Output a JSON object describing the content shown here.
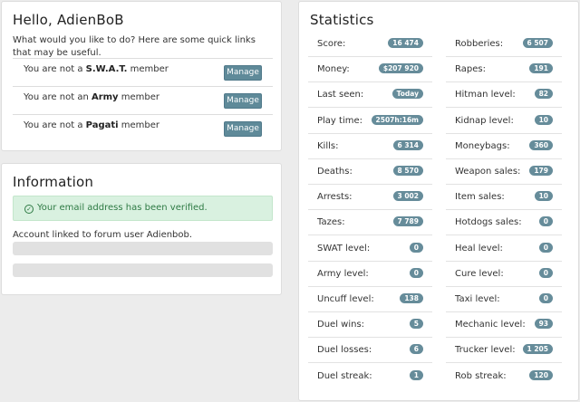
{
  "hello": {
    "title": "Hello, AdienBoB",
    "intro": "What would you like to do? Here are some quick links that may be useful.",
    "memberships": [
      {
        "prefix": "You are not a ",
        "org": "S.W.A.T.",
        "suffix": " member",
        "button": "Manage"
      },
      {
        "prefix": "You are not an ",
        "org": "Army",
        "suffix": " member",
        "button": "Manage"
      },
      {
        "prefix": "You are not a ",
        "org": "Pagati",
        "suffix": " member",
        "button": "Manage"
      }
    ]
  },
  "information": {
    "title": "Information",
    "alert": "Your email address has been verified.",
    "linked": "Account linked to forum user Adienbob."
  },
  "statistics": {
    "title": "Statistics",
    "left": [
      {
        "label": "Score:",
        "value": "16 474"
      },
      {
        "label": "Money:",
        "value": "$207 920"
      },
      {
        "label": "Last seen:",
        "value": "Today"
      },
      {
        "label": "Play time:",
        "value": "2507h:16m"
      },
      {
        "label": "Kills:",
        "value": "6 314"
      },
      {
        "label": "Deaths:",
        "value": "8 570"
      },
      {
        "label": "Arrests:",
        "value": "3 002"
      },
      {
        "label": "Tazes:",
        "value": "7 789"
      },
      {
        "label": "SWAT level:",
        "value": "0"
      },
      {
        "label": "Army level:",
        "value": "0"
      },
      {
        "label": "Uncuff level:",
        "value": "138"
      },
      {
        "label": "Duel wins:",
        "value": "5"
      },
      {
        "label": "Duel losses:",
        "value": "6"
      },
      {
        "label": "Duel streak:",
        "value": "1"
      }
    ],
    "right": [
      {
        "label": "Robberies:",
        "value": "6 507"
      },
      {
        "label": "Rapes:",
        "value": "191"
      },
      {
        "label": "Hitman level:",
        "value": "82"
      },
      {
        "label": "Kidnap level:",
        "value": "10"
      },
      {
        "label": "Moneybags:",
        "value": "360"
      },
      {
        "label": "Weapon sales:",
        "value": "179"
      },
      {
        "label": "Item sales:",
        "value": "10"
      },
      {
        "label": "Hotdogs sales:",
        "value": "0"
      },
      {
        "label": "Heal level:",
        "value": "0"
      },
      {
        "label": "Cure level:",
        "value": "0"
      },
      {
        "label": "Taxi level:",
        "value": "0"
      },
      {
        "label": "Mechanic level:",
        "value": "93"
      },
      {
        "label": "Trucker level:",
        "value": "1 205"
      },
      {
        "label": "Rob streak:",
        "value": "120"
      }
    ]
  },
  "colors": {
    "badge": "#668c9a",
    "button": "#5f8a99",
    "alert_bg": "#d9f1e0",
    "alert_text": "#2e7a44"
  }
}
